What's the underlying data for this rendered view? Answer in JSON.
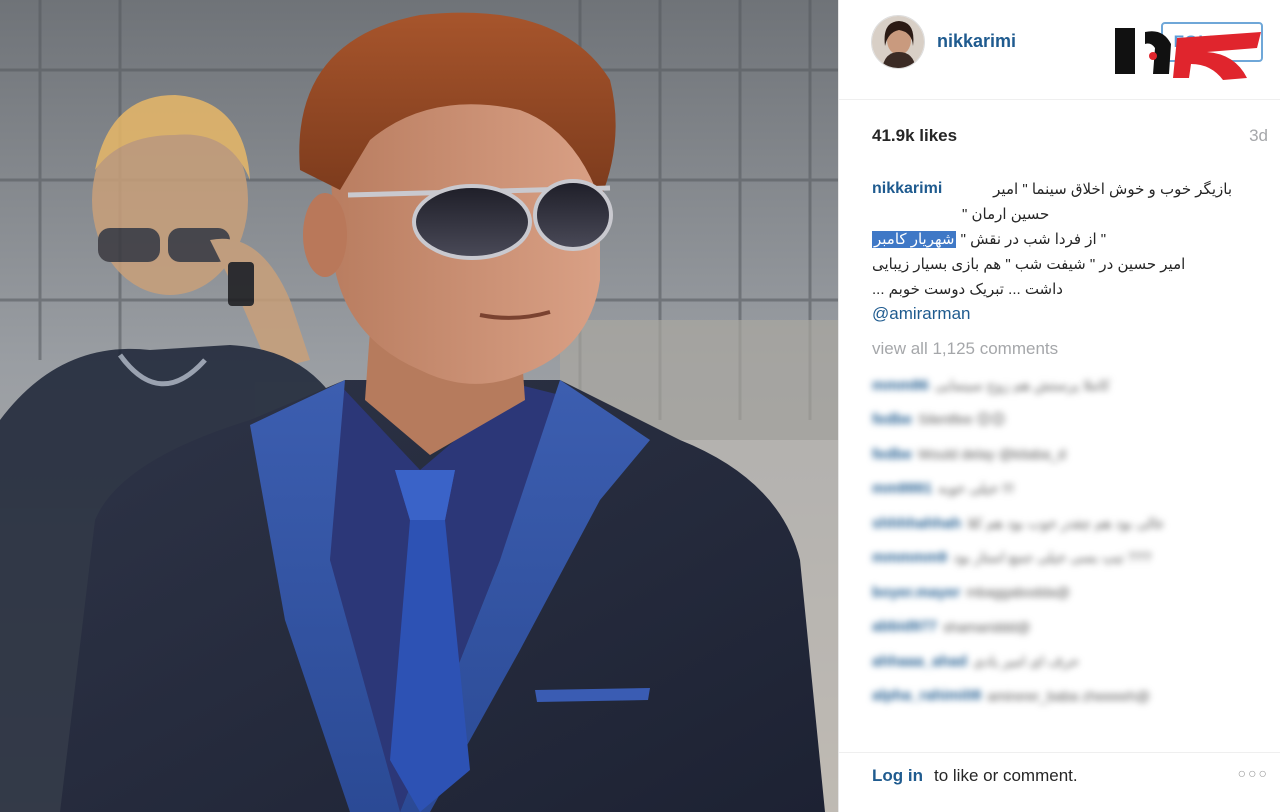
{
  "post": {
    "username": "nikkarimi",
    "follow_label": "FOLLOW",
    "likes": "41.9k likes",
    "age": "3d",
    "caption_user": "nikkarimi",
    "caption_lines": [
      "بازیگر خوب و خوش اخلاق سینما \" امیر",
      "حسین ارمان \"",
      "\" از فردا شب در نقش \"",
      "امیر حسین در \" شیفت شب \" هم بازی بسیار زیبایی",
      "داشت ... تبریک دوست خوبم ..."
    ],
    "caption_highlight": "شهریار کامبر",
    "mention": "@amirarman",
    "view_all": "view all 1,125 comments"
  },
  "comments": [
    {
      "user": "mmm86",
      "text": "کاملا پرستش هم زوج سینمایی"
    },
    {
      "user": "fedbe",
      "text": "😊😊 Silentfee"
    },
    {
      "user": "fedbe",
      "text": "Would delay @kitaba_d"
    },
    {
      "user": "mm9991",
      "text": "!!! خیلی خوبه"
    },
    {
      "user": "shhhhahhah",
      "text": "عالی بود هم چقدر خوب بود هم کلا"
    },
    {
      "user": "mmmmm9",
      "text": "??? تیپ بسی خیلی جمع استار بود"
    },
    {
      "user": "boyer.mayer",
      "text": "@mbaggabodda"
    },
    {
      "user": "abbid977",
      "text": "@shamariddd"
    },
    {
      "user": "ahhaaa_ahad",
      "text": "حرف ای امیر یادی"
    },
    {
      "user": "alpha_rahimi08",
      "text": "@amirerer_baba zheeeeh"
    }
  ],
  "footer": {
    "login_label": "Log in",
    "login_rest": "to like or comment.",
    "more_icon": "ellipsis-icon"
  },
  "colors": {
    "link": "#1f5b8f",
    "muted": "#a5a7aa",
    "highlight": "#3f78c6",
    "logo_red": "#e0252d",
    "logo_black": "#111111"
  }
}
